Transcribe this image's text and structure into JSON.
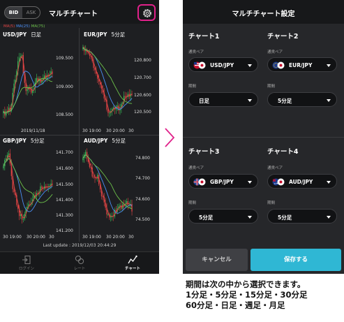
{
  "left_screen": {
    "bid_label": "BID",
    "ask_label": "ASK",
    "title": "マルチチャート",
    "settings_icon": "gear-icon",
    "ma_legend": {
      "ma5": "MA(5)",
      "ma25": "MA(25)",
      "ma75": "MA(75)"
    },
    "ma_colors": {
      "ma5": "#e14444",
      "ma25": "#4a8ff5",
      "ma75": "#6cc04a"
    },
    "charts": [
      {
        "symbol": "USD/JPY",
        "timeframe": "日足",
        "y_labels": [
          "109.500",
          "109.000",
          "108.500"
        ],
        "x_labels": [
          "2019/11/18"
        ]
      },
      {
        "symbol": "EUR/JPY",
        "timeframe": "5分足",
        "y_labels": [
          "120.800",
          "120.700",
          "120.600",
          "120.500"
        ],
        "x_labels": [
          "30 19:00",
          "30 20:00",
          "30"
        ]
      },
      {
        "symbol": "GBP/JPY",
        "timeframe": "5分足",
        "y_labels": [
          "141.700",
          "141.600",
          "141.500",
          "141.400",
          "141.300",
          "141.200"
        ],
        "x_labels": [
          "30 19:00",
          "30 20:00",
          "30"
        ]
      },
      {
        "symbol": "AUD/JPY",
        "timeframe": "5分足",
        "y_labels": [
          "74.800",
          "74.700",
          "74.600",
          "74.500"
        ],
        "x_labels": [
          "30 19:00",
          "30 20:00",
          "30"
        ]
      }
    ],
    "last_update": "Last update : 2019/12/03 20:44:29",
    "tabs": [
      {
        "label": "ログイン",
        "icon": "login-icon"
      },
      {
        "label": "レート",
        "icon": "rate-icon"
      },
      {
        "label": "チャート",
        "icon": "chart-icon"
      }
    ]
  },
  "right_screen": {
    "title": "マルチチャート設定",
    "pair_label": "通貨ペア",
    "period_label": "期間",
    "charts": [
      {
        "title": "チャート1",
        "pair": "USD/JPY",
        "flag": "usd-jpy-flag-icon",
        "period": "日足"
      },
      {
        "title": "チャート2",
        "pair": "EUR/JPY",
        "flag": "eur-jpy-flag-icon",
        "period": "5分足"
      },
      {
        "title": "チャート3",
        "pair": "GBP/JPY",
        "flag": "gbp-jpy-flag-icon",
        "period": "5分足"
      },
      {
        "title": "チャート4",
        "pair": "AUD/JPY",
        "flag": "aud-jpy-flag-icon",
        "period": "5分足"
      }
    ],
    "cancel_label": "キャンセル",
    "save_label": "保存する"
  },
  "caption": {
    "line1": "期間は次の中から選択できます。",
    "line2": "1分足・5分足・15分足・30分足",
    "line3": "60分足・日足・週足・月足"
  },
  "accent_colors": {
    "highlight": "#e0218a",
    "save": "#2fb7d4"
  }
}
